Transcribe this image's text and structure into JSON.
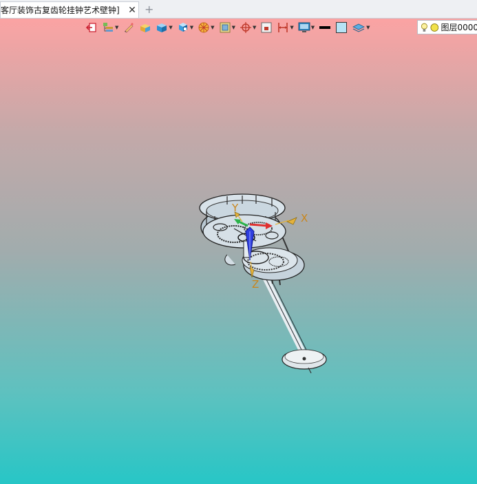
{
  "tab": {
    "title": "客厅装饰古复齿轮挂钟艺术壁钟]",
    "close_glyph": "✕",
    "new_tab_glyph": "+"
  },
  "toolbar": {
    "items": [
      {
        "icon": "exit-sketch-icon",
        "has_dropdown": false
      },
      {
        "icon": "layers-tree-icon",
        "has_dropdown": true
      },
      {
        "icon": "pencil-icon",
        "has_dropdown": false
      },
      {
        "icon": "solid-box-icon",
        "has_dropdown": false
      },
      {
        "icon": "shaded-cube-icon",
        "has_dropdown": true
      },
      {
        "icon": "view-cube-icon",
        "has_dropdown": true
      },
      {
        "icon": "render-wheel-icon",
        "has_dropdown": true
      },
      {
        "icon": "material-icon",
        "has_dropdown": true
      },
      {
        "icon": "crosshair-icon",
        "has_dropdown": true
      },
      {
        "icon": "frame-icon",
        "has_dropdown": false
      },
      {
        "icon": "dimension-icon",
        "has_dropdown": true
      },
      {
        "icon": "display-icon",
        "has_dropdown": true
      },
      {
        "icon": "line-color-icon",
        "has_dropdown": false
      },
      {
        "icon": "fill-color-icon",
        "has_dropdown": false
      },
      {
        "icon": "layer-stack-icon",
        "has_dropdown": true
      }
    ],
    "layer": {
      "name": "图层0000"
    }
  },
  "viewport": {
    "axes": {
      "x": "X",
      "y": "Y",
      "z": "Z"
    },
    "gradient_top": "#fba3a3",
    "gradient_bottom": "#27c6c6"
  }
}
